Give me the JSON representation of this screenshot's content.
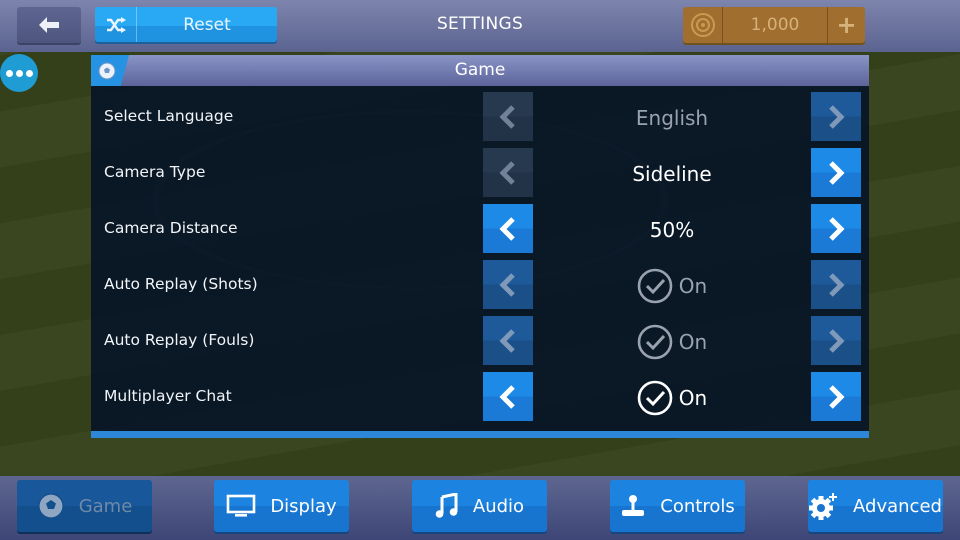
{
  "topbar": {
    "back_icon": "arrow-left-icon",
    "reset": {
      "icon": "shuffle-icon",
      "label": "Reset"
    },
    "title": "SETTINGS",
    "coins": {
      "icon": "coin-icon",
      "value": "1,000",
      "add_icon": "plus-icon"
    }
  },
  "more_button": {
    "icon": "ellipsis-icon"
  },
  "panel": {
    "icon": "soccer-ball-icon",
    "title": "Game",
    "rows": [
      {
        "label": "Select Language",
        "value": "English",
        "checked": false,
        "left_state": "disabled",
        "right_state": "enabled",
        "value_dim": true
      },
      {
        "label": "Camera Type",
        "value": "Sideline",
        "checked": false,
        "left_state": "disabled",
        "right_state": "active",
        "value_dim": false
      },
      {
        "label": "Camera Distance",
        "value": "50%",
        "checked": false,
        "left_state": "active",
        "right_state": "active",
        "value_dim": false
      },
      {
        "label": "Auto Replay (Shots)",
        "value": "On",
        "checked": true,
        "left_state": "enabled",
        "right_state": "enabled",
        "value_dim": true
      },
      {
        "label": "Auto Replay (Fouls)",
        "value": "On",
        "checked": true,
        "left_state": "enabled",
        "right_state": "enabled",
        "value_dim": true
      },
      {
        "label": "Multiplayer Chat",
        "value": "On",
        "checked": true,
        "left_state": "active",
        "right_state": "active",
        "value_dim": false
      }
    ]
  },
  "tabs": [
    {
      "label": "Game",
      "icon": "soccer-ball-icon",
      "current": true
    },
    {
      "label": "Display",
      "icon": "monitor-icon",
      "current": false
    },
    {
      "label": "Audio",
      "icon": "music-note-icon",
      "current": false
    },
    {
      "label": "Controls",
      "icon": "joystick-icon",
      "current": false
    },
    {
      "label": "Advanced",
      "icon": "gear-plus-icon",
      "current": false
    }
  ]
}
